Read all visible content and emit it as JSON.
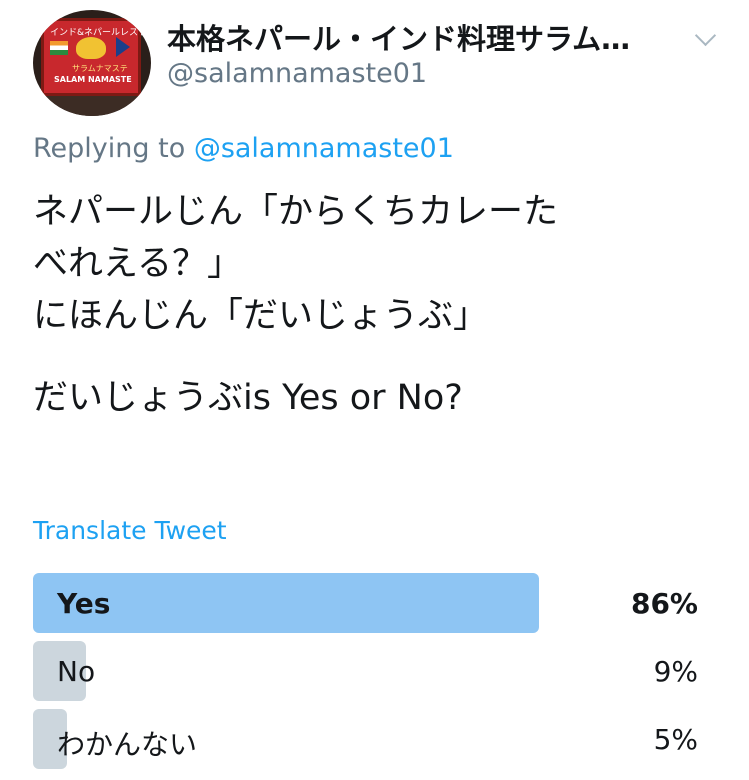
{
  "profile": {
    "display_name": "本格ネパール・インド料理サラム…",
    "handle": "@salamnamaste01",
    "avatar_sign": {
      "line1": "インド&ネパールレストラン",
      "line2": "サラムナマステ",
      "line3": "SALAM NAMASTE"
    }
  },
  "reply": {
    "prefix": "Replying to",
    "mention": "@salamnamaste01"
  },
  "tweet": {
    "lines": [
      "ネパールじん「からくちカレーた",
      "べれえる？」",
      "にほんじん「だいじょうぶ」",
      "だいじょうぶis Yes or No?"
    ]
  },
  "translate_label": "Translate Tweet",
  "poll": {
    "options": [
      {
        "label": "Yes",
        "percent_text": "86%",
        "percent": 86,
        "winner": true
      },
      {
        "label": "No",
        "percent_text": "9%",
        "percent": 9,
        "winner": false
      },
      {
        "label": "わかんない",
        "percent_text": "5%",
        "percent": 5,
        "winner": false
      }
    ]
  },
  "colors": {
    "link": "#1da1f2",
    "secondary_text": "#657786",
    "poll_winner": "#8ec5f3",
    "poll_other": "#ccd6dd"
  },
  "icons": {
    "more": "chevron-down-icon"
  }
}
